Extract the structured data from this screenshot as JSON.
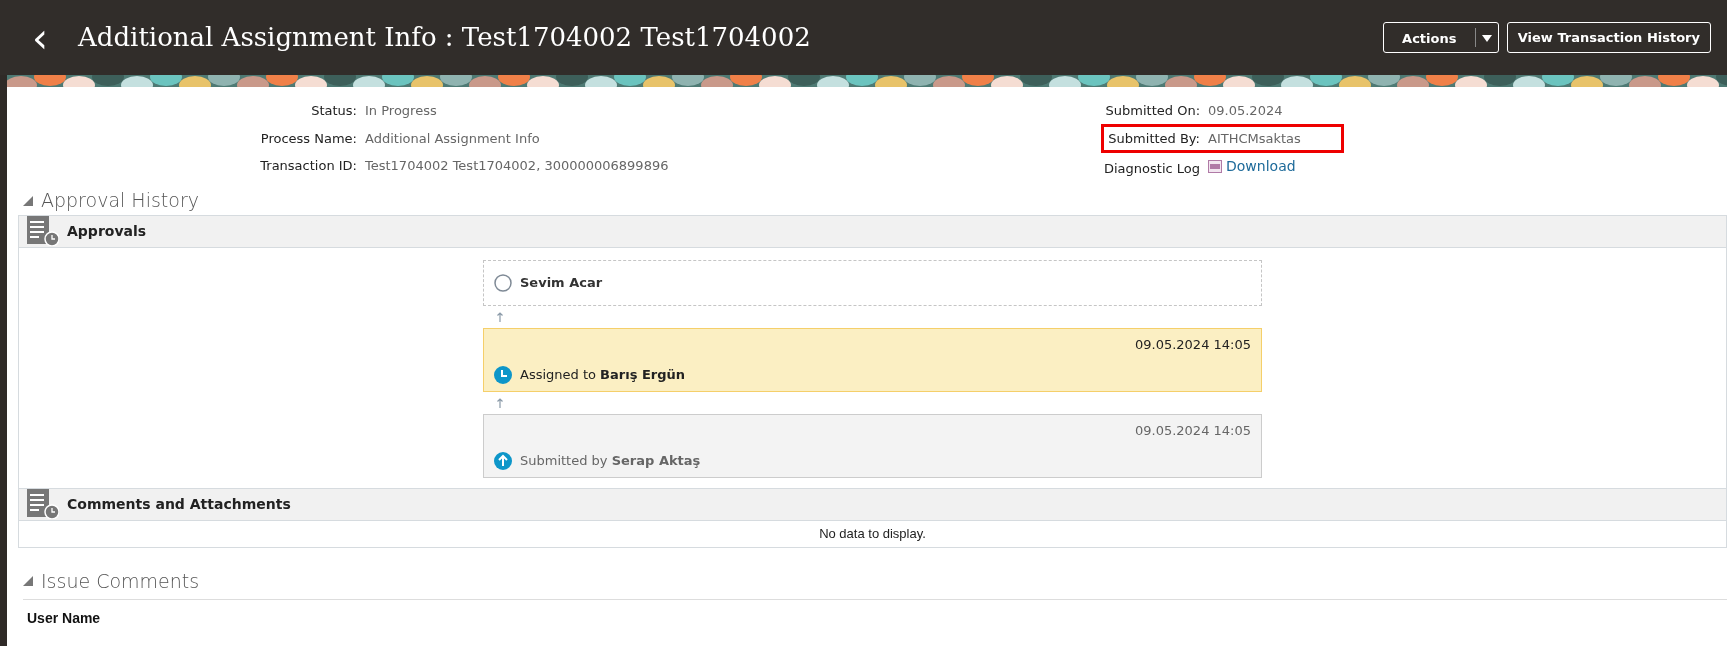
{
  "header": {
    "back_icon": "‹",
    "title": "Additional Assignment Info : Test1704002 Test1704002",
    "actions_button": "Actions",
    "history_button": "View Transaction History"
  },
  "info_left": [
    {
      "label": "Status:",
      "value": "In Progress"
    },
    {
      "label": "Process Name:",
      "value": "Additional Assignment Info"
    },
    {
      "label": "Transaction ID:",
      "value": "Test1704002 Test1704002, 300000006899896"
    }
  ],
  "info_right": [
    {
      "label": "Submitted On:",
      "value": "09.05.2024",
      "highlighted": false,
      "kind": "text"
    },
    {
      "label": "Submitted By:",
      "value": "AITHCMsaktas",
      "highlighted": true,
      "kind": "text"
    },
    {
      "label": "Diagnostic Log",
      "value": "Download",
      "highlighted": false,
      "kind": "link"
    }
  ],
  "approval_history": {
    "title": "Approval History",
    "expanded": true,
    "approvals": {
      "title": "Approvals",
      "steps": [
        {
          "kind": "pending",
          "person": "Sevim Acar"
        },
        {
          "kind": "assigned",
          "date": "09.05.2024 14:05",
          "action": "Assigned to",
          "person": "Barış Ergün"
        },
        {
          "kind": "submitted",
          "date": "09.05.2024 14:05",
          "action": "Submitted by",
          "person": "Serap Aktaş"
        }
      ]
    },
    "comments": {
      "title": "Comments and Attachments",
      "empty_text": "No data to display."
    }
  },
  "issue_comments": {
    "title": "Issue Comments",
    "expanded": true,
    "column": "User Name"
  }
}
